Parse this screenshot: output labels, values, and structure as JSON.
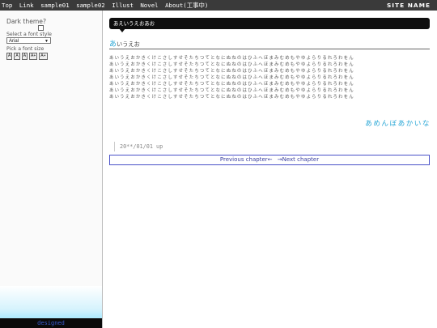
{
  "nav": {
    "links": [
      "Top",
      "Link",
      "sample01",
      "sample02",
      "Illust",
      "Novel",
      "About(工事中)"
    ],
    "site_name": "SITE NAME"
  },
  "sidebar": {
    "dark_theme_label": "Dark theme?",
    "font_style_label": "Select a font style",
    "font_style_value": "Arial",
    "font_size_label": "Pick a font size",
    "size_buttons": [
      "A",
      "A",
      "A",
      "A+",
      "A+"
    ],
    "footer_text": "designed"
  },
  "main": {
    "chapter_tab": "あえいうえおあお",
    "heading_first": "あ",
    "heading_rest": "いうえお",
    "body_lines": [
      "あいうえおかきくけこさしすせそたちつてとなにぬねのはひふへほまみむめもやゆよらりるれろわをん",
      "あいうえおかきくけこさしすせそたちつてとなにぬねのはひふへほまみむめもやゆよらりるれろわをん",
      "あいうえおかきくけこさしすせそたちつてとなにぬねのはひふへほまみむめもやゆよらりるれろわをん",
      "あいうえおかきくけこさしすせそたちつてとなにぬねのはひふへほまみむめもやゆよらりるれろわをん",
      "あいうえおかきくけこさしすせそたちつてとなにぬねのはひふへほまみむめもやゆよらりるれろわをん",
      "あいうえおかきくけこさしすせそたちつてとなにぬねのはひふへほまみむめもやゆよらりるれろわをん",
      "あいうえおかきくけこさしすせそたちつてとなにぬねのはひふへほまみむめもやゆよらりるれろわをん"
    ],
    "signoff": "あめんぼあかいな",
    "date": "20**/01/01 up",
    "prev_label": "Previous chapter←",
    "next_label": "→Next chapter"
  }
}
